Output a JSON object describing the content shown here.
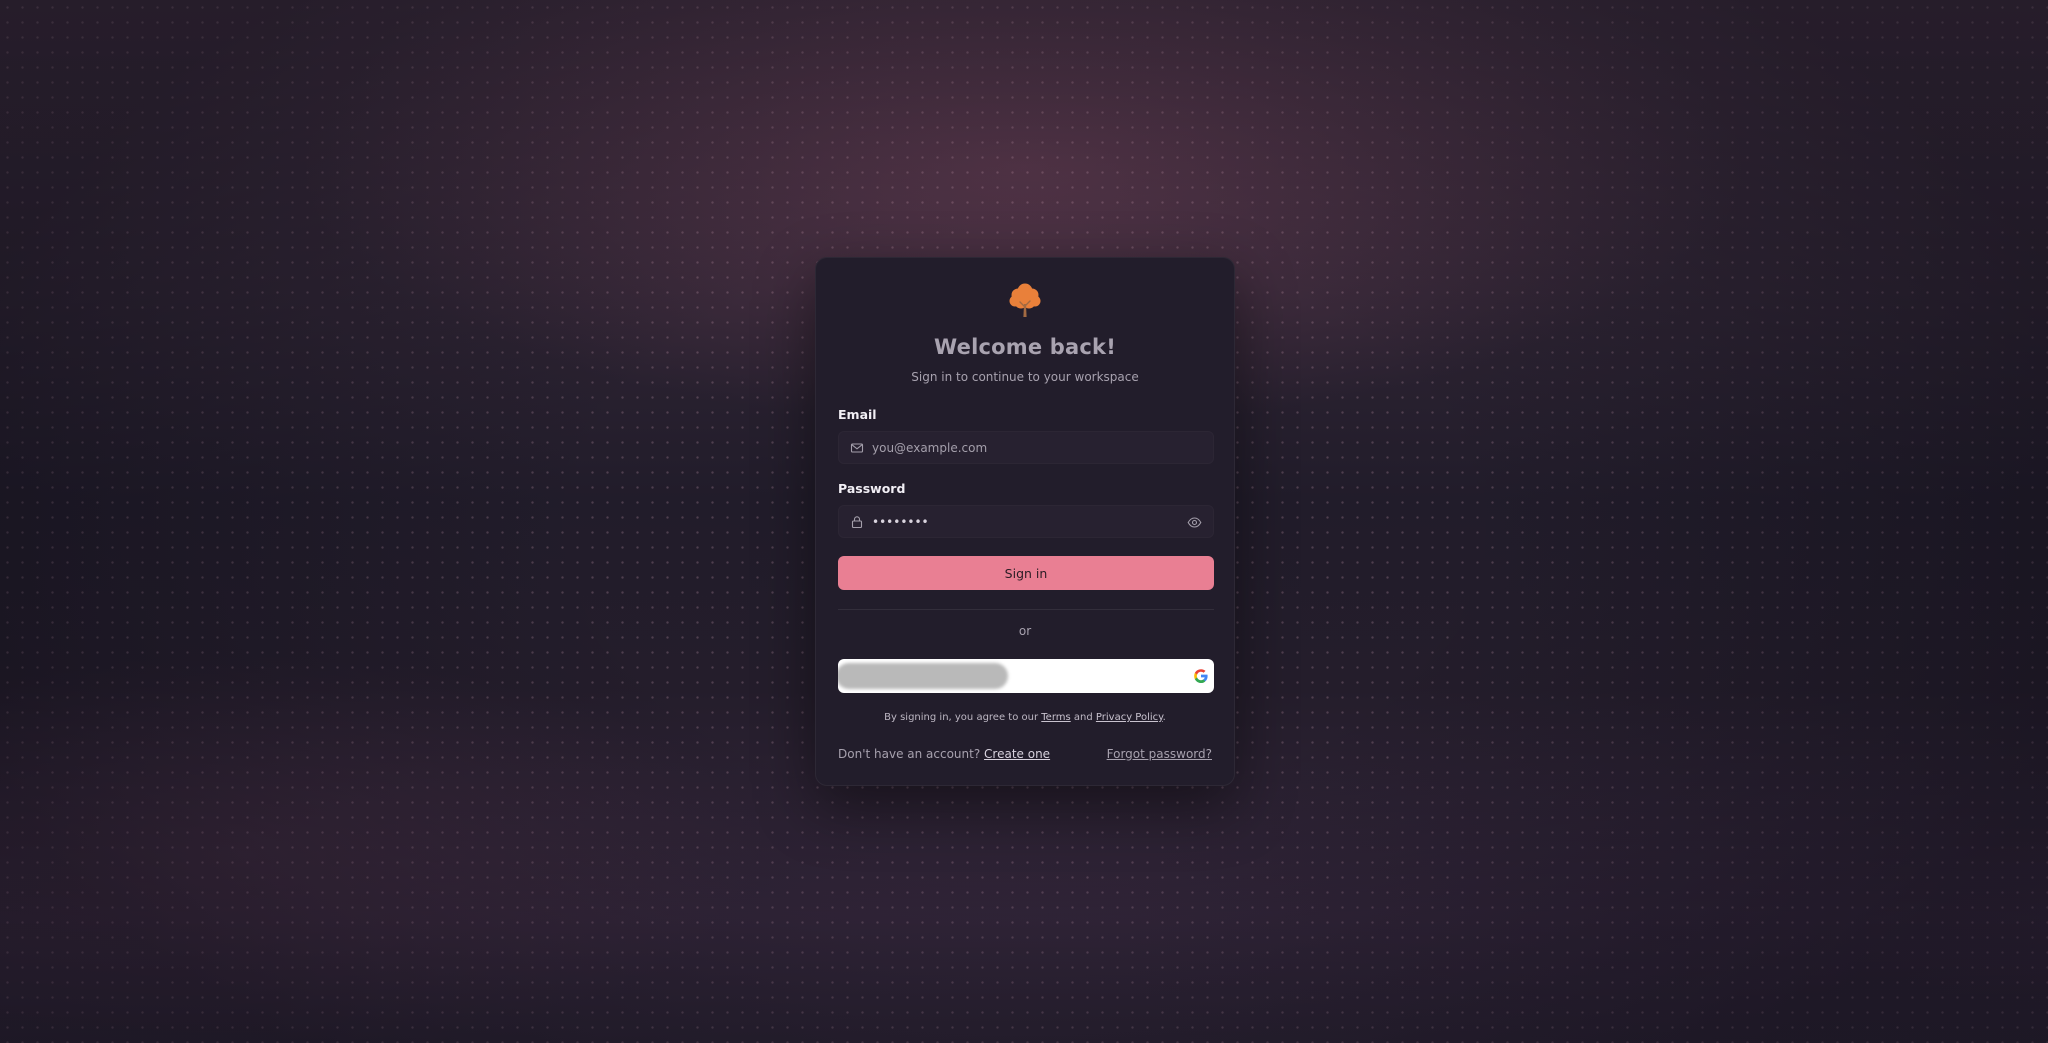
{
  "brand": {
    "logo_icon": "tree-icon",
    "accent_color": "#e9803a"
  },
  "header": {
    "title": "Welcome back!",
    "subtitle": "Sign in to continue to your workspace"
  },
  "form": {
    "email": {
      "label": "Email",
      "icon": "mail-icon",
      "placeholder": "you@example.com",
      "value": ""
    },
    "password": {
      "label": "Password",
      "icon": "lock-icon",
      "value": "••••••••",
      "toggle_icon": "eye-icon"
    },
    "submit_label": "Sign in",
    "submit_color": "#e97f93"
  },
  "divider_text": "or",
  "google_button": {
    "icon": "google-icon"
  },
  "legal": {
    "prefix": "By signing in, you agree to our",
    "terms": "Terms",
    "and": "and",
    "privacy": "Privacy Policy",
    "suffix": "."
  },
  "footer": {
    "no_account": "Don't have an account?",
    "create_link": "Create one",
    "forgot_link": "Forgot password?"
  }
}
